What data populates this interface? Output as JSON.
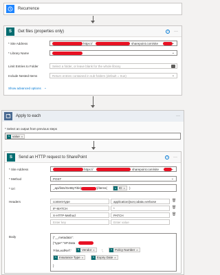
{
  "recurrence": {
    "title": "Recurrence",
    "accent": "#1f85ff"
  },
  "get_files": {
    "title": "Get files (properties only)",
    "accent": "#036c70",
    "site_address_label": "* Site Address",
    "site_address_value_mid": "https://",
    "site_address_value_end": "sharepoint.com/site",
    "library_label": "* Library Name",
    "limit_label": "Limit Entries to Folder",
    "limit_placeholder": "Select a folder, or leave blank for the whole library",
    "nested_label": "Include Nested Items",
    "nested_placeholder": "Return entries contained in sub-folders (default = true)",
    "advanced_link": "Show advanced options"
  },
  "apply_each": {
    "title": "Apply to each",
    "accent": "#486991",
    "select_label": "* Select an output from previous steps",
    "token_value": "value"
  },
  "http_request": {
    "title": "Send an HTTP request to SharePoint",
    "accent": "#036c70",
    "site_address_label": "* Site Address",
    "site_address_value_mid": "https://",
    "site_address_value_end": "sharepoint.com/site",
    "method_label": "* Method",
    "method_value": "POST",
    "uri_label": "* Uri",
    "uri_prefix": "_api/lists/GetByTitle('",
    "uri_suffix": "')/items(",
    "uri_token": "ID",
    "uri_close": ")",
    "headers_label": "Headers",
    "headers": [
      {
        "key": "content-type",
        "value": "application/json;odata=verbose"
      },
      {
        "key": "IF-MATCH",
        "value": "*"
      },
      {
        "key": "X-HTTP-Method",
        "value": "PATCH"
      }
    ],
    "header_key_placeholder": "Enter key",
    "header_value_placeholder": "Enter value",
    "body_label": "Body",
    "body_line1": "{\"__metadata\":",
    "body_line2_a": "{\"type\":\"SP.Data",
    "body_line3_a": "'FileLeafRef':'",
    "token_vendor": "Vendor",
    "body_mid1": "',",
    "token_policy": "Policy Number",
    "token_insurance": "Insurance Type",
    "token_expiry": "Expiry Date",
    "body_close": "}"
  }
}
